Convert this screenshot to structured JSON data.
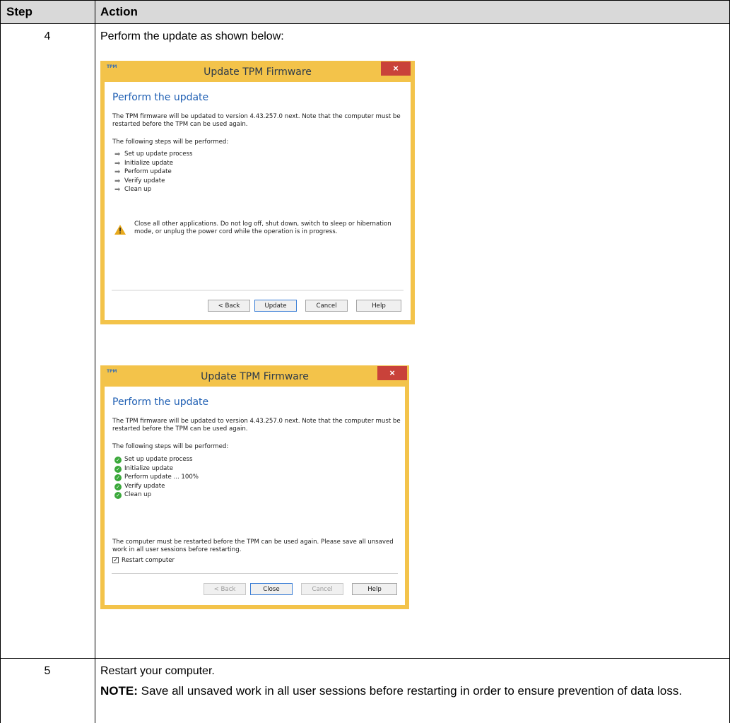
{
  "table": {
    "headers": {
      "step": "Step",
      "action": "Action"
    },
    "rows": [
      {
        "step": "4",
        "action": "Perform the update as shown below:"
      },
      {
        "step": "5",
        "action": "Restart your computer.",
        "note_label": "NOTE:",
        "note_text": "Save all unsaved work in all user sessions before restarting in order to ensure prevention of data loss."
      }
    ]
  },
  "dialog1": {
    "app_icon": "TPM",
    "title": "Update TPM Firmware",
    "close": "×",
    "heading": "Perform the update",
    "intro": "The TPM firmware will be updated to version 4.43.257.0 next. Note that the computer must be restarted before the TPM can be used again.",
    "steps_label": "The following steps will be performed:",
    "steps": [
      "Set up update process",
      "Initialize update",
      "Perform update",
      "Verify update",
      "Clean up"
    ],
    "step_icon": "arrow-icon",
    "warning": "Close all other applications. Do not log off, shut down, switch to sleep or hibernation mode, or unplug the power cord while the operation is in progress.",
    "buttons": {
      "back": "< Back",
      "update": "Update",
      "cancel": "Cancel",
      "help": "Help"
    }
  },
  "dialog2": {
    "app_icon": "TPM",
    "title": "Update TPM Firmware",
    "close": "×",
    "heading": "Perform the update",
    "intro": "The TPM firmware will be updated to version 4.43.257.0 next. Note that the computer must be restarted before the TPM can be used again.",
    "steps_label": "The following steps will be performed:",
    "steps": [
      "Set up update process",
      "Initialize update",
      "Perform update ... 100%",
      "Verify update",
      "Clean up"
    ],
    "step_icon": "check-icon",
    "restart_msg": "The computer must be restarted before the TPM can be used again. Please save all unsaved work in all user sessions before restarting.",
    "restart_checkbox": {
      "label": "Restart computer",
      "checked": true
    },
    "buttons": {
      "back": "< Back",
      "close": "Close",
      "cancel": "Cancel",
      "help": "Help"
    }
  },
  "colors": {
    "dialog_frame": "#f3c34a",
    "close_button": "#c9423a",
    "heading_blue": "#1f5fb3",
    "check_green": "#3aa83a",
    "header_gray": "#d9d9d9"
  }
}
